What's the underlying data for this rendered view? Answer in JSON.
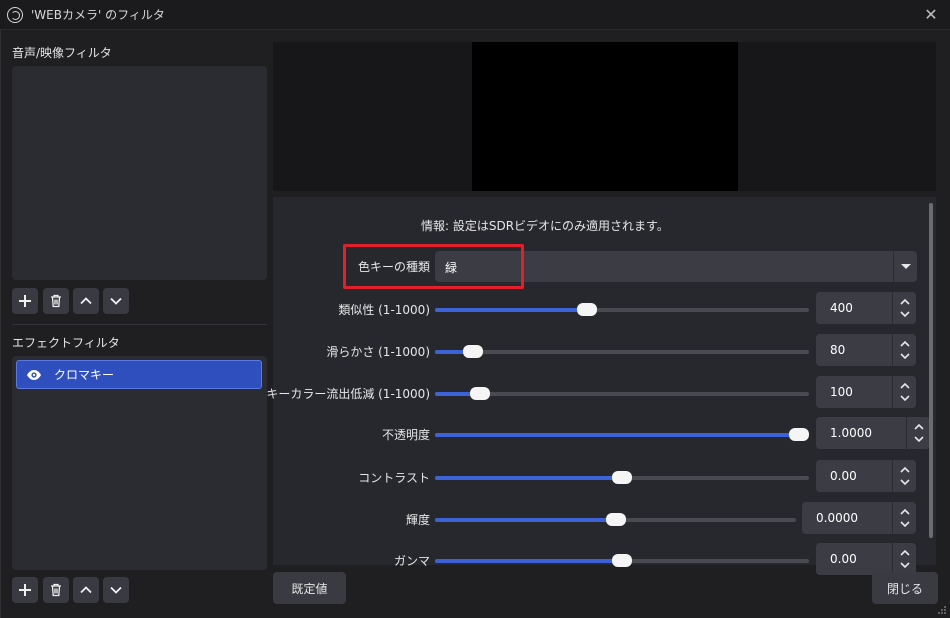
{
  "window": {
    "title": "'WEBカメラ' のフィルタ"
  },
  "left": {
    "audio_video_section": "音声/映像フィルタ",
    "effect_section": "エフェクトフィルタ",
    "effect_filters": [
      {
        "label": "クロマキー",
        "visible": true
      }
    ]
  },
  "props": {
    "info": "情報: 設定はSDRビデオにのみ適用されます。",
    "key_type": {
      "label": "色キーの種類",
      "value": "緑"
    },
    "rows": [
      {
        "label": "類似性 (1-1000)",
        "value": "400",
        "fraction": 0.4
      },
      {
        "label": "滑らかさ (1-1000)",
        "value": "80",
        "fraction": 0.08
      },
      {
        "label": "キーカラー流出低減 (1-1000)",
        "value": "100",
        "fraction": 0.1
      },
      {
        "label": "不透明度",
        "value": "1.0000",
        "fraction": 1.0
      },
      {
        "label": "コントラスト",
        "value": "0.00",
        "fraction": 0.5
      },
      {
        "label": "輝度",
        "value": "0.0000",
        "fraction": 0.5
      },
      {
        "label": "ガンマ",
        "value": "0.00",
        "fraction": 0.5
      }
    ]
  },
  "buttons": {
    "defaults": "既定値",
    "close": "閉じる"
  },
  "colors": {
    "accent": "#3d62d8",
    "highlight": "#e0202a",
    "selected_item": "#2f4fbf"
  }
}
